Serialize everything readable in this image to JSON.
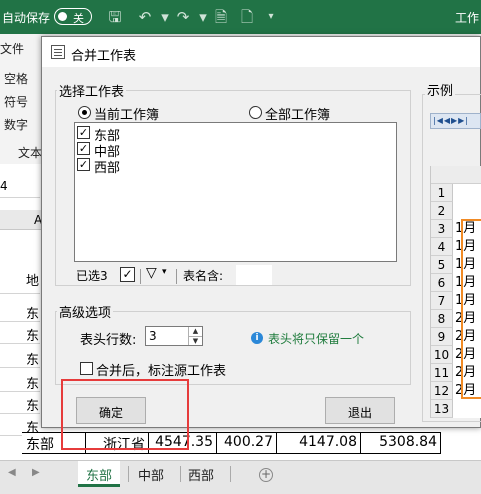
{
  "excel": {
    "autosave_label": "自动保存",
    "toggle_label": "关",
    "window_title": "工作",
    "ribbon": {
      "file_tab": "文件",
      "font_group_1": "空格",
      "font_group_2": "符号",
      "font_group_3": "数字",
      "font_group_4": "文本"
    },
    "namebox_value": "4",
    "col_header_fragment": "A",
    "left_cells": [
      "地",
      "东",
      "东",
      "东",
      "东",
      "东",
      "东"
    ],
    "bottom_row": {
      "col_a": "东部",
      "col_b": "浙江省",
      "col_c": "4547.35",
      "col_d": "400.27",
      "col_e": "4147.08",
      "col_f": "5308.84"
    },
    "sheet_tabs": [
      "东部",
      "中部",
      "西部"
    ],
    "accent_color": "#217346"
  },
  "dialog": {
    "title": "合并工作表",
    "select_group_label": "选择工作表",
    "radio_current": "当前工作簿",
    "radio_all": "全部工作簿",
    "sheets": [
      {
        "name": "东部",
        "checked": "✓"
      },
      {
        "name": "中部",
        "checked": "✓"
      },
      {
        "name": "西部",
        "checked": "✓"
      }
    ],
    "selected_count_label": "已选3",
    "filter_icon_label": "▾",
    "table_name_label": "表名含:",
    "advanced_group_label": "高级选项",
    "header_rows_label": "表头行数:",
    "header_rows_value": "3",
    "info_text": "表头将只保留一个",
    "mark_source_label": "合并后，标注源工作表",
    "ok_button": "确定",
    "exit_button": "退出",
    "preview_label": "示例",
    "preview_rows": [
      {
        "num": "1",
        "text": ""
      },
      {
        "num": "2",
        "text": ""
      },
      {
        "num": "3",
        "text": "1月"
      },
      {
        "num": "4",
        "text": "1月"
      },
      {
        "num": "5",
        "text": "1月"
      },
      {
        "num": "6",
        "text": "1月"
      },
      {
        "num": "7",
        "text": "1月"
      },
      {
        "num": "8",
        "text": "2月"
      },
      {
        "num": "9",
        "text": "2月"
      },
      {
        "num": "10",
        "text": "2月"
      },
      {
        "num": "11",
        "text": "2月"
      },
      {
        "num": "12",
        "text": "2月"
      },
      {
        "num": "13",
        "text": ""
      }
    ],
    "highlight_color": "#e63b3b",
    "preview_highlight_color": "#f08a24",
    "info_color": "#1e7b3c"
  }
}
